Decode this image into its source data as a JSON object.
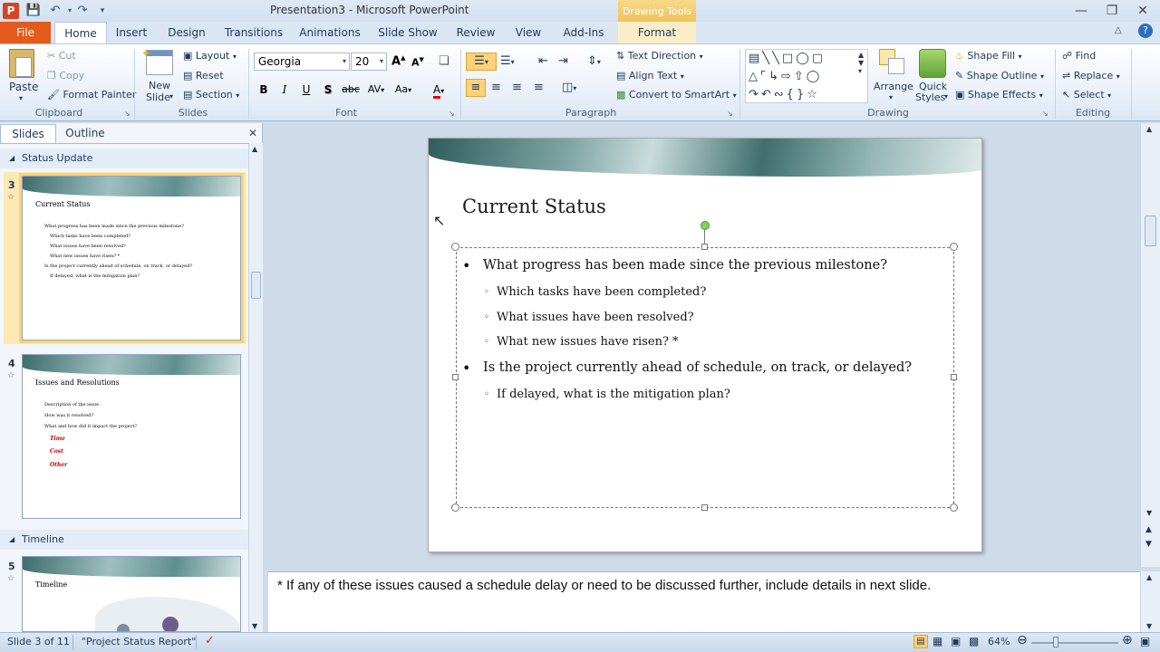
{
  "app": {
    "title": "Presentation3 - Microsoft PowerPoint",
    "context_tab_group": "Drawing Tools"
  },
  "tabs": [
    "File",
    "Home",
    "Insert",
    "Design",
    "Transitions",
    "Animations",
    "Slide Show",
    "Review",
    "View",
    "Add-Ins",
    "Format"
  ],
  "ribbon": {
    "clipboard": {
      "paste": "Paste",
      "cut": "Cut",
      "copy": "Copy",
      "format_painter": "Format Painter",
      "label": "Clipboard"
    },
    "slides": {
      "new_slide_1": "New",
      "new_slide_2": "Slide",
      "layout": "Layout",
      "reset": "Reset",
      "section": "Section",
      "label": "Slides"
    },
    "font": {
      "family": "Georgia",
      "size": "20",
      "label": "Font"
    },
    "paragraph": {
      "text_direction": "Text Direction",
      "align_text": "Align Text",
      "convert_smartart": "Convert to SmartArt",
      "label": "Paragraph"
    },
    "drawing": {
      "arrange": "Arrange",
      "quick_styles_1": "Quick",
      "quick_styles_2": "Styles",
      "shape_fill": "Shape Fill",
      "shape_outline": "Shape Outline",
      "shape_effects": "Shape Effects",
      "label": "Drawing"
    },
    "editing": {
      "find": "Find",
      "replace": "Replace",
      "select": "Select",
      "label": "Editing"
    }
  },
  "left_pane": {
    "tab_slides": "Slides",
    "tab_outline": "Outline",
    "sections": [
      "Status Update",
      "Timeline"
    ],
    "thumbs": [
      {
        "num": "3",
        "title": "Current Status",
        "lines": [
          {
            "t": "What progress has been made since the previous milestone?",
            "lvl": 1
          },
          {
            "t": "Which tasks have been completed?",
            "lvl": 2
          },
          {
            "t": "What issues have been resolved?",
            "lvl": 2
          },
          {
            "t": "What new issues have risen? *",
            "lvl": 2
          },
          {
            "t": "Is the project currently ahead of schedule, on track, or delayed?",
            "lvl": 1
          },
          {
            "t": "If delayed, what is the mitigation plan?",
            "lvl": 2
          }
        ]
      },
      {
        "num": "4",
        "title": "Issues and Resolutions",
        "lines": [
          {
            "t": "Description of the issue",
            "lvl": 1
          },
          {
            "t": "How was it resolved?",
            "lvl": 1
          },
          {
            "t": "What and how did it impact the project?",
            "lvl": 1
          },
          {
            "t": "Time",
            "lvl": 3
          },
          {
            "t": "Cost",
            "lvl": 3
          },
          {
            "t": "Other",
            "lvl": 3
          }
        ]
      },
      {
        "num": "5",
        "title": "Timeline",
        "lines": []
      }
    ]
  },
  "slide": {
    "title": "Current Status",
    "bullets": [
      {
        "text": "What progress has been made since the previous milestone?",
        "level": 1
      },
      {
        "text": "Which tasks have been completed?",
        "level": 2
      },
      {
        "text": "What issues have been resolved?",
        "level": 2
      },
      {
        "text": "What new issues have risen? *",
        "level": 2
      },
      {
        "text": "Is the project currently ahead of schedule, on track, or delayed?",
        "level": 1
      },
      {
        "text": "If delayed, what is the mitigation plan?",
        "level": 2
      }
    ]
  },
  "notes": "* If any of these issues caused a schedule delay or need to be discussed further, include details in next slide.",
  "status": {
    "slide_info": "Slide 3 of 11",
    "theme": "\"Project Status Report\"",
    "zoom": "64%"
  },
  "colors": {
    "file_tab": "#e35b1a",
    "context_tab": "#f0c35a",
    "selection": "#fbd278",
    "accent": "#2b5797"
  }
}
